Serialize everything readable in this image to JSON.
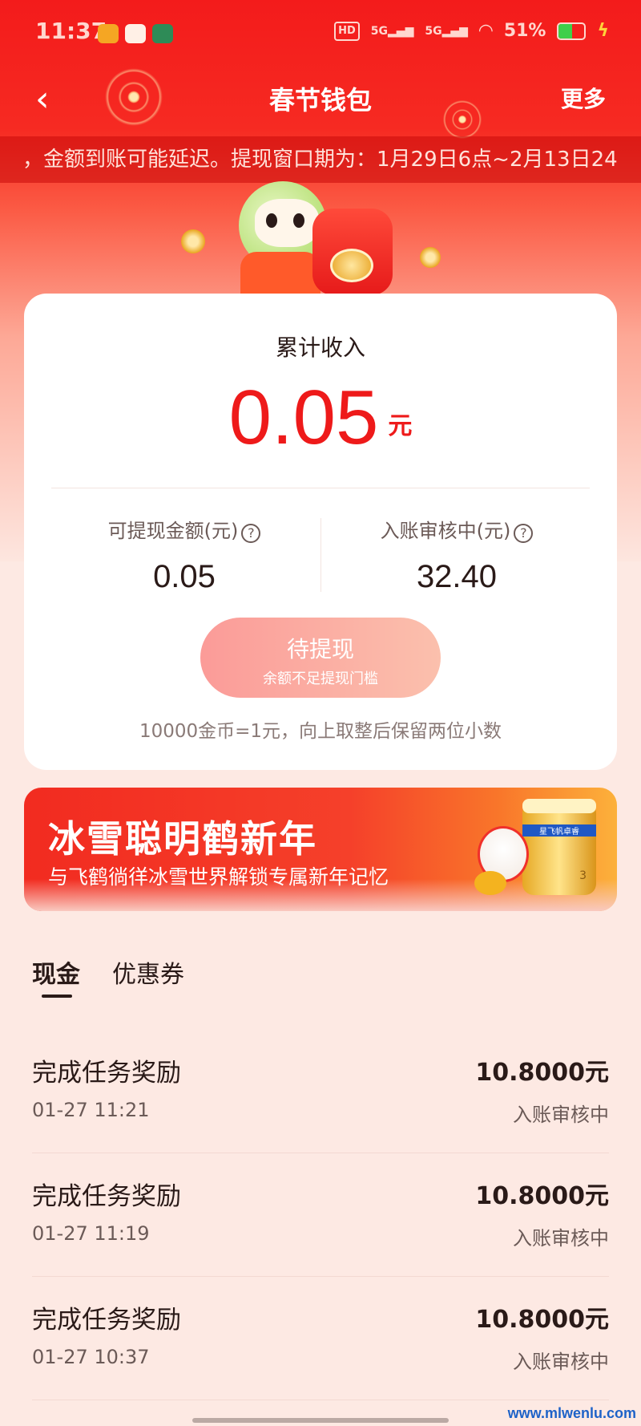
{
  "status_bar": {
    "time": "11:37",
    "hd_label": "HD",
    "signal1": "5G",
    "signal2": "5G",
    "battery": "51%",
    "battery_level": 0.51
  },
  "nav": {
    "back_glyph": "‹",
    "title": "春节钱包",
    "more": "更多"
  },
  "ticker": {
    "text": "，金额到账可能延迟。提现窗口期为：1月29日6点~2月13日24"
  },
  "income": {
    "label": "累计收入",
    "value": "0.05",
    "unit": "元"
  },
  "stats": {
    "withdrawable_label": "可提现金额(元)",
    "withdrawable_value": "0.05",
    "pending_label": "入账审核中(元)",
    "pending_value": "32.40",
    "help_glyph": "?"
  },
  "withdraw_button": {
    "label": "待提现",
    "sublabel": "余额不足提现门槛"
  },
  "rule_text": "10000金币=1元，向上取整后保留两位小数",
  "banner": {
    "title": "冰雪聪明鹤新年",
    "subtitle": "与飞鹤徜徉冰雪世界解锁专属新年记忆",
    "can_text": "星飞帆卓睿",
    "can_number": "3"
  },
  "tabs": [
    {
      "label": "现金",
      "active": true
    },
    {
      "label": "优惠券",
      "active": false
    }
  ],
  "transactions": [
    {
      "title": "完成任务奖励",
      "time": "01-27 11:21",
      "amount": "10.8000元",
      "status": "入账审核中"
    },
    {
      "title": "完成任务奖励",
      "time": "01-27 11:19",
      "amount": "10.8000元",
      "status": "入账审核中"
    },
    {
      "title": "完成任务奖励",
      "time": "01-27 10:37",
      "amount": "10.8000元",
      "status": "入账审核中"
    }
  ],
  "watermark": "www.mlwenlu.com",
  "colors": {
    "primary_red": "#ee1a1a",
    "header_red": "#f31b1b",
    "button_pink": "#fb9b98",
    "page_bg": "#fde9e3"
  }
}
